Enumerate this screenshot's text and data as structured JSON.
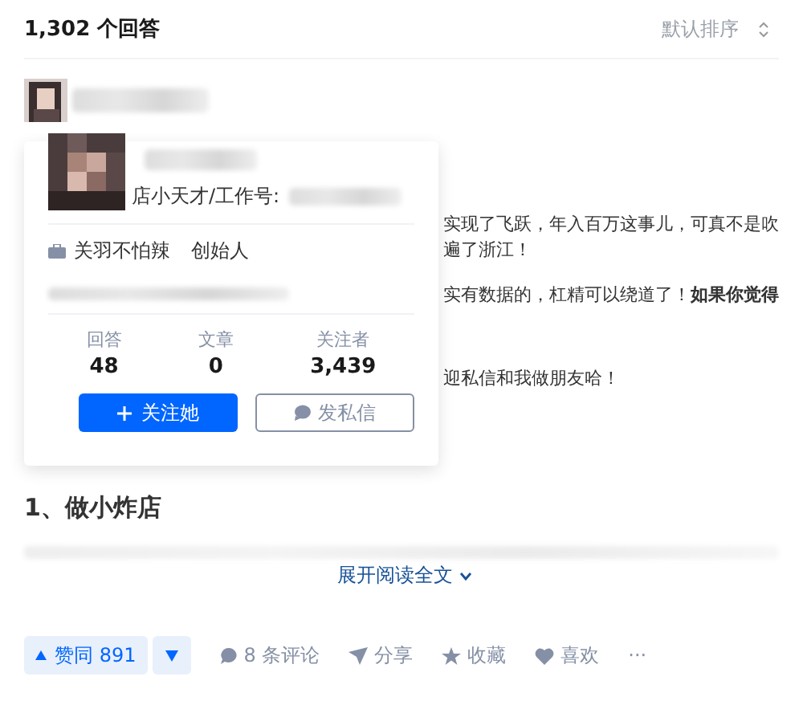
{
  "header": {
    "answer_count": "1,302 个回答",
    "sort": "默认排序"
  },
  "answer_paragraphs": [
    [
      "实现了飞跃，年入百万这事儿，可真不是吹",
      "遍了浙江！"
    ],
    [
      "实有数据的，杠精可以绕道了！**如果你觉得**"
    ],
    [
      "迎私信和我做朋友哈！"
    ]
  ],
  "profile_card": {
    "headline": "店小天才/工作号:",
    "company": "关羽不怕辣",
    "position": "创始人",
    "stats": [
      {
        "label": "回答",
        "value": "48"
      },
      {
        "label": "文章",
        "value": "0"
      },
      {
        "label": "关注者",
        "value": "3,439"
      }
    ],
    "follow_button": "关注她",
    "message_button": "发私信"
  },
  "section_heading": "1、做小炸店",
  "expand_link": "展开阅读全文",
  "actions": {
    "upvote": "赞同 891",
    "comments": "8 条评论",
    "share": "分享",
    "favorite": "收藏",
    "like": "喜欢",
    "more": "···"
  }
}
